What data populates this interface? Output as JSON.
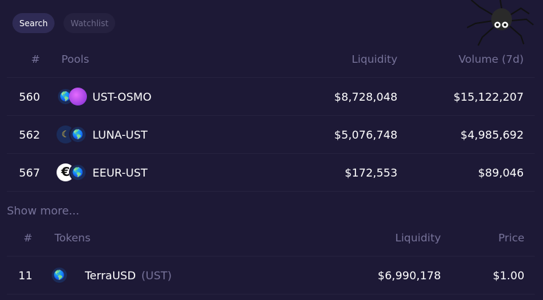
{
  "tabs": [
    {
      "label": "Search",
      "active": true
    },
    {
      "label": "Watchlist",
      "active": false
    }
  ],
  "pools": {
    "headers": {
      "index": "#",
      "name": "Pools",
      "liquidity": "Liquidity",
      "volume": "Volume (7d)"
    },
    "rows": [
      {
        "id": "560",
        "name": "UST-OSMO",
        "liquidity": "$8,728,048",
        "volume": "$15,122,207",
        "icons": [
          "ust",
          "osmo"
        ]
      },
      {
        "id": "562",
        "name": "LUNA-UST",
        "liquidity": "$5,076,748",
        "volume": "$4,985,692",
        "icons": [
          "luna",
          "ust"
        ]
      },
      {
        "id": "567",
        "name": "EEUR-UST",
        "liquidity": "$172,553",
        "volume": "$89,046",
        "icons": [
          "eeur",
          "ust"
        ]
      }
    ]
  },
  "show_more": "Show more...",
  "tokens": {
    "headers": {
      "index": "#",
      "name": "Tokens",
      "liquidity": "Liquidity",
      "price": "Price"
    },
    "rows": [
      {
        "id": "11",
        "name": "TerraUSD",
        "symbol": "(UST)",
        "liquidity": "$6,990,178",
        "price": "$1.00",
        "icon": "ust"
      }
    ]
  }
}
